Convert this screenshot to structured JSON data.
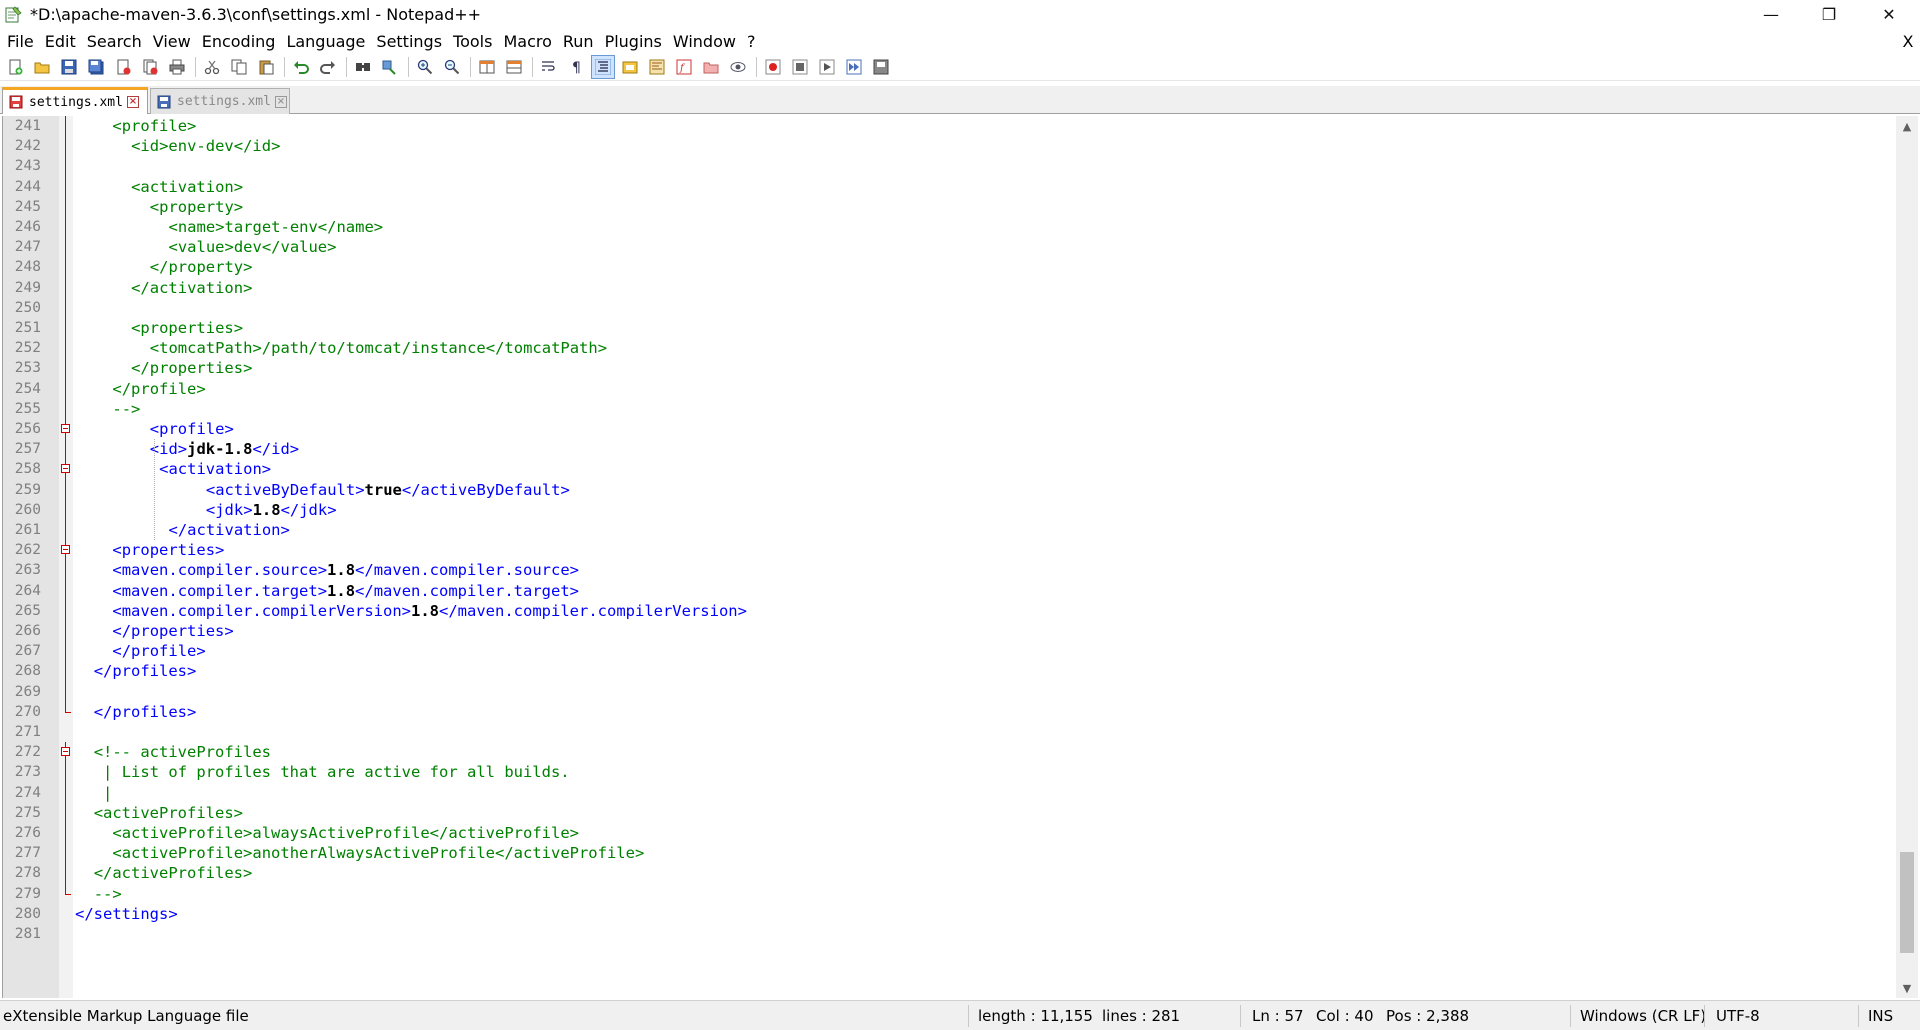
{
  "window": {
    "title": "*D:\\apache-maven-3.6.3\\conf\\settings.xml - Notepad++",
    "minimize_glyph": "—",
    "maximize_glyph": "❐",
    "close_glyph": "✕"
  },
  "menu": {
    "items": [
      {
        "label": "File",
        "name": "menu-file"
      },
      {
        "label": "Edit",
        "name": "menu-edit"
      },
      {
        "label": "Search",
        "name": "menu-search"
      },
      {
        "label": "View",
        "name": "menu-view"
      },
      {
        "label": "Encoding",
        "name": "menu-encoding"
      },
      {
        "label": "Language",
        "name": "menu-language"
      },
      {
        "label": "Settings",
        "name": "menu-settings"
      },
      {
        "label": "Tools",
        "name": "menu-tools"
      },
      {
        "label": "Macro",
        "name": "menu-macro"
      },
      {
        "label": "Run",
        "name": "menu-run"
      },
      {
        "label": "Plugins",
        "name": "menu-plugins"
      },
      {
        "label": "Window",
        "name": "menu-window"
      },
      {
        "label": "?",
        "name": "menu-help"
      }
    ],
    "close_doc_glyph": "X"
  },
  "tabs": [
    {
      "label": "settings.xml",
      "active": true,
      "close_glyph": "×"
    },
    {
      "label": "settings.xml",
      "active": false,
      "close_glyph": "×"
    }
  ],
  "editor": {
    "lines": [
      {
        "n": "241",
        "indent": 4,
        "parts": [
          {
            "t": "<profile>",
            "c": "green"
          }
        ]
      },
      {
        "n": "242",
        "indent": 6,
        "parts": [
          {
            "t": "<id>env-dev</id>",
            "c": "green"
          }
        ]
      },
      {
        "n": "243",
        "indent": 0,
        "parts": []
      },
      {
        "n": "244",
        "indent": 6,
        "parts": [
          {
            "t": "<activation>",
            "c": "green"
          }
        ]
      },
      {
        "n": "245",
        "indent": 8,
        "parts": [
          {
            "t": "<property>",
            "c": "green"
          }
        ]
      },
      {
        "n": "246",
        "indent": 10,
        "parts": [
          {
            "t": "<name>target-env</name>",
            "c": "green"
          }
        ]
      },
      {
        "n": "247",
        "indent": 10,
        "parts": [
          {
            "t": "<value>dev</value>",
            "c": "green"
          }
        ]
      },
      {
        "n": "248",
        "indent": 8,
        "parts": [
          {
            "t": "</property>",
            "c": "green"
          }
        ]
      },
      {
        "n": "249",
        "indent": 6,
        "parts": [
          {
            "t": "</activation>",
            "c": "green"
          }
        ]
      },
      {
        "n": "250",
        "indent": 0,
        "parts": []
      },
      {
        "n": "251",
        "indent": 6,
        "parts": [
          {
            "t": "<properties>",
            "c": "green"
          }
        ]
      },
      {
        "n": "252",
        "indent": 8,
        "parts": [
          {
            "t": "<tomcatPath>/path/to/tomcat/instance</tomcatPath>",
            "c": "green"
          }
        ]
      },
      {
        "n": "253",
        "indent": 6,
        "parts": [
          {
            "t": "</properties>",
            "c": "green"
          }
        ]
      },
      {
        "n": "254",
        "indent": 4,
        "parts": [
          {
            "t": "</profile>",
            "c": "green"
          }
        ]
      },
      {
        "n": "255",
        "indent": 4,
        "parts": [
          {
            "t": "-->",
            "c": "green"
          }
        ]
      },
      {
        "n": "256",
        "indent": 8,
        "parts": [
          {
            "t": "<profile>",
            "c": "blue"
          }
        ]
      },
      {
        "n": "257",
        "indent": 8,
        "parts": [
          {
            "t": "<id>",
            "c": "blue"
          },
          {
            "t": "jdk-1.8",
            "c": "black"
          },
          {
            "t": "</id>",
            "c": "blue"
          }
        ]
      },
      {
        "n": "258",
        "indent": 9,
        "parts": [
          {
            "t": "<activation>",
            "c": "blue"
          }
        ]
      },
      {
        "n": "259",
        "indent": 14,
        "parts": [
          {
            "t": "<activeByDefault>",
            "c": "blue"
          },
          {
            "t": "true",
            "c": "black"
          },
          {
            "t": "</activeByDefault>",
            "c": "blue"
          }
        ]
      },
      {
        "n": "260",
        "indent": 14,
        "parts": [
          {
            "t": "<jdk>",
            "c": "blue"
          },
          {
            "t": "1.8",
            "c": "black"
          },
          {
            "t": "</jdk>",
            "c": "blue"
          }
        ]
      },
      {
        "n": "261",
        "indent": 10,
        "parts": [
          {
            "t": "</activation>",
            "c": "blue"
          }
        ]
      },
      {
        "n": "262",
        "indent": 4,
        "parts": [
          {
            "t": "<properties>",
            "c": "blue"
          }
        ]
      },
      {
        "n": "263",
        "indent": 4,
        "parts": [
          {
            "t": "<maven.compiler.source>",
            "c": "blue"
          },
          {
            "t": "1.8",
            "c": "black"
          },
          {
            "t": "</maven.compiler.source>",
            "c": "blue"
          }
        ]
      },
      {
        "n": "264",
        "indent": 4,
        "parts": [
          {
            "t": "<maven.compiler.target>",
            "c": "blue"
          },
          {
            "t": "1.8",
            "c": "black"
          },
          {
            "t": "</maven.compiler.target>",
            "c": "blue"
          }
        ]
      },
      {
        "n": "265",
        "indent": 4,
        "parts": [
          {
            "t": "<maven.compiler.compilerVersion>",
            "c": "blue"
          },
          {
            "t": "1.8",
            "c": "black"
          },
          {
            "t": "</maven.compiler.compilerVersion>",
            "c": "blue"
          }
        ]
      },
      {
        "n": "266",
        "indent": 4,
        "parts": [
          {
            "t": "</properties>",
            "c": "blue"
          }
        ]
      },
      {
        "n": "267",
        "indent": 4,
        "parts": [
          {
            "t": "</profile>",
            "c": "blue"
          }
        ]
      },
      {
        "n": "268",
        "indent": 2,
        "parts": [
          {
            "t": "</profiles>",
            "c": "blue"
          }
        ]
      },
      {
        "n": "269",
        "indent": 0,
        "parts": []
      },
      {
        "n": "270",
        "indent": 2,
        "parts": [
          {
            "t": "</profiles>",
            "c": "blue"
          }
        ]
      },
      {
        "n": "271",
        "indent": 0,
        "parts": []
      },
      {
        "n": "272",
        "indent": 2,
        "parts": [
          {
            "t": "<!-- activeProfiles",
            "c": "green"
          }
        ]
      },
      {
        "n": "273",
        "indent": 3,
        "parts": [
          {
            "t": "| List of profiles that are active for all builds.",
            "c": "green"
          }
        ]
      },
      {
        "n": "274",
        "indent": 3,
        "parts": [
          {
            "t": "|",
            "c": "green"
          }
        ]
      },
      {
        "n": "275",
        "indent": 2,
        "parts": [
          {
            "t": "<activeProfiles>",
            "c": "green"
          }
        ]
      },
      {
        "n": "276",
        "indent": 4,
        "parts": [
          {
            "t": "<activeProfile>alwaysActiveProfile</activeProfile>",
            "c": "green"
          }
        ]
      },
      {
        "n": "277",
        "indent": 4,
        "parts": [
          {
            "t": "<activeProfile>anotherAlwaysActiveProfile</activeProfile>",
            "c": "green"
          }
        ]
      },
      {
        "n": "278",
        "indent": 2,
        "parts": [
          {
            "t": "</activeProfiles>",
            "c": "green"
          }
        ]
      },
      {
        "n": "279",
        "indent": 2,
        "parts": [
          {
            "t": "-->",
            "c": "green"
          }
        ]
      },
      {
        "n": "280",
        "indent": 0,
        "parts": [
          {
            "t": "</settings>",
            "c": "blue"
          }
        ]
      },
      {
        "n": "281",
        "indent": 0,
        "parts": []
      }
    ]
  },
  "scrollbar": {
    "up_glyph": "▲",
    "down_glyph": "▼",
    "thumb_start": 0.85,
    "thumb_size": 0.12
  },
  "status": {
    "file_type": "eXtensible Markup Language file",
    "length": "length : 11,155",
    "lines": "lines : 281",
    "ln": "Ln : 57",
    "col": "Col : 40",
    "pos": "Pos : 2,388",
    "eol": "Windows (CR LF)",
    "encoding": "UTF-8",
    "mode": "INS"
  },
  "colors": {
    "comment": "#008000",
    "tag": "#0000ff",
    "text": "#000000",
    "fold": "#cc0000",
    "tab_accent": "#f5a623"
  },
  "toolbar_icons": [
    "new-file-icon",
    "open-file-icon",
    "save-icon",
    "save-all-icon",
    "close-icon",
    "close-all-icon",
    "print-icon",
    "cut-icon",
    "copy-icon",
    "paste-icon",
    "undo-icon",
    "redo-icon",
    "find-icon",
    "replace-icon",
    "zoom-in-icon",
    "zoom-out-icon",
    "sync-vertical-icon",
    "sync-horizontal-icon",
    "word-wrap-icon",
    "show-all-chars-icon",
    "indent-guide-icon",
    "user-lang-icon",
    "doc-map-icon",
    "function-list-icon",
    "folder-workspace-icon",
    "monitor-icon",
    "record-macro-icon",
    "stop-macro-icon",
    "play-macro-icon",
    "run-macro-multiple-icon",
    "save-macro-icon"
  ]
}
